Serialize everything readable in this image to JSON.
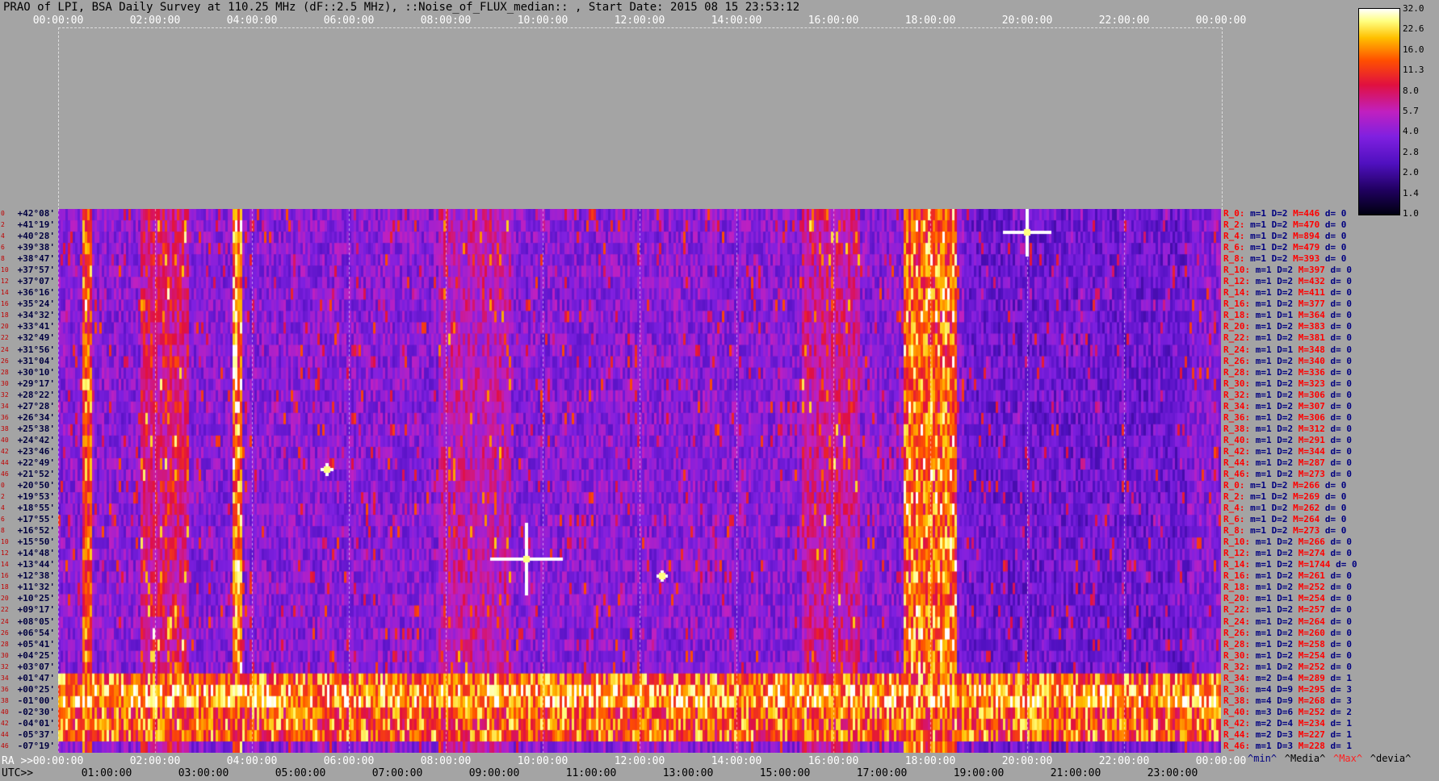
{
  "title": "PRAO of LPI, BSA Daily Survey at 110.25 MHz (dF::2.5 MHz), ::Noise_of_FLUX_median:: , Start Date: 2015 08 15 23:53:12",
  "top_ticks": [
    "00:00:00",
    "02:00:00",
    "04:00:00",
    "06:00:00",
    "08:00:00",
    "10:00:00",
    "12:00:00",
    "14:00:00",
    "16:00:00",
    "18:00:00",
    "20:00:00",
    "22:00:00",
    "00:00:00"
  ],
  "ra_label": "RA >>",
  "utc_label": "UTC>>",
  "ra_ticks": [
    "00:00:00",
    "02:00:00",
    "04:00:00",
    "06:00:00",
    "08:00:00",
    "10:00:00",
    "12:00:00",
    "14:00:00",
    "16:00:00",
    "18:00:00",
    "20:00:00",
    "22:00:00",
    "00:00:00"
  ],
  "utc_ticks": [
    "01:00:00",
    "03:00:00",
    "05:00:00",
    "07:00:00",
    "09:00:00",
    "11:00:00",
    "13:00:00",
    "15:00:00",
    "17:00:00",
    "19:00:00",
    "21:00:00",
    "23:00:00"
  ],
  "colorbar_labels": [
    "32.0",
    "22.6",
    "16.0",
    "11.3",
    "8.0",
    "5.7",
    "4.0",
    "2.8",
    "2.0",
    "1.4",
    "1.0"
  ],
  "legend_keys": {
    "min": "^min^",
    "median": "^Media^",
    "max": "^Max^",
    "devia": "^devia^"
  },
  "colors": {
    "background": "#a4a4a4",
    "stat_label": "#ff0000",
    "stat_value": "#000080",
    "max_key": "#ff2020"
  },
  "chart_data": {
    "type": "heatmap",
    "x_axis": "Right Ascension / UTC",
    "x_range": [
      "00:00:00",
      "24:00:00"
    ],
    "color_scale": [
      1.0,
      32.0
    ],
    "rows": [
      {
        "idx": "0",
        "dec": "+42°08'",
        "stat": {
          "r": "R_0:",
          "m": "m=1",
          "D": "D=2",
          "M": "M=446",
          "d": "d= 0"
        }
      },
      {
        "idx": "2",
        "dec": "+41°19'",
        "stat": {
          "r": "R_2:",
          "m": "m=1",
          "D": "D=2",
          "M": "M=470",
          "d": "d= 0"
        }
      },
      {
        "idx": "4",
        "dec": "+40°28'",
        "stat": {
          "r": "R_4:",
          "m": "m=1",
          "D": "D=2",
          "M": "M=894",
          "d": "d= 0"
        }
      },
      {
        "idx": "6",
        "dec": "+39°38'",
        "stat": {
          "r": "R_6:",
          "m": "m=1",
          "D": "D=2",
          "M": "M=479",
          "d": "d= 0"
        }
      },
      {
        "idx": "8",
        "dec": "+38°47'",
        "stat": {
          "r": "R_8:",
          "m": "m=1",
          "D": "D=2",
          "M": "M=393",
          "d": "d= 0"
        }
      },
      {
        "idx": "10",
        "dec": "+37°57'",
        "stat": {
          "r": "R_10:",
          "m": "m=1",
          "D": "D=2",
          "M": "M=397",
          "d": "d= 0"
        }
      },
      {
        "idx": "12",
        "dec": "+37°07'",
        "stat": {
          "r": "R_12:",
          "m": "m=1",
          "D": "D=2",
          "M": "M=432",
          "d": "d= 0"
        }
      },
      {
        "idx": "14",
        "dec": "+36°16'",
        "stat": {
          "r": "R_14:",
          "m": "m=1",
          "D": "D=2",
          "M": "M=411",
          "d": "d= 0"
        }
      },
      {
        "idx": "16",
        "dec": "+35°24'",
        "stat": {
          "r": "R_16:",
          "m": "m=1",
          "D": "D=2",
          "M": "M=377",
          "d": "d= 0"
        }
      },
      {
        "idx": "18",
        "dec": "+34°32'",
        "stat": {
          "r": "R_18:",
          "m": "m=1",
          "D": "D=1",
          "M": "M=364",
          "d": "d= 0"
        }
      },
      {
        "idx": "20",
        "dec": "+33°41'",
        "stat": {
          "r": "R_20:",
          "m": "m=1",
          "D": "D=2",
          "M": "M=383",
          "d": "d= 0"
        }
      },
      {
        "idx": "22",
        "dec": "+32°49'",
        "stat": {
          "r": "R_22:",
          "m": "m=1",
          "D": "D=2",
          "M": "M=381",
          "d": "d= 0"
        }
      },
      {
        "idx": "24",
        "dec": "+31°56'",
        "stat": {
          "r": "R_24:",
          "m": "m=1",
          "D": "D=1",
          "M": "M=348",
          "d": "d= 0"
        }
      },
      {
        "idx": "26",
        "dec": "+31°04'",
        "stat": {
          "r": "R_26:",
          "m": "m=1",
          "D": "D=2",
          "M": "M=340",
          "d": "d= 0"
        }
      },
      {
        "idx": "28",
        "dec": "+30°10'",
        "stat": {
          "r": "R_28:",
          "m": "m=1",
          "D": "D=2",
          "M": "M=336",
          "d": "d= 0"
        }
      },
      {
        "idx": "30",
        "dec": "+29°17'",
        "stat": {
          "r": "R_30:",
          "m": "m=1",
          "D": "D=2",
          "M": "M=323",
          "d": "d= 0"
        }
      },
      {
        "idx": "32",
        "dec": "+28°22'",
        "stat": {
          "r": "R_32:",
          "m": "m=1",
          "D": "D=2",
          "M": "M=306",
          "d": "d= 0"
        }
      },
      {
        "idx": "34",
        "dec": "+27°28'",
        "stat": {
          "r": "R_34:",
          "m": "m=1",
          "D": "D=2",
          "M": "M=307",
          "d": "d= 0"
        }
      },
      {
        "idx": "36",
        "dec": "+26°34'",
        "stat": {
          "r": "R_36:",
          "m": "m=1",
          "D": "D=2",
          "M": "M=306",
          "d": "d= 0"
        }
      },
      {
        "idx": "38",
        "dec": "+25°38'",
        "stat": {
          "r": "R_38:",
          "m": "m=1",
          "D": "D=2",
          "M": "M=312",
          "d": "d= 0"
        }
      },
      {
        "idx": "40",
        "dec": "+24°42'",
        "stat": {
          "r": "R_40:",
          "m": "m=1",
          "D": "D=2",
          "M": "M=291",
          "d": "d= 0"
        }
      },
      {
        "idx": "42",
        "dec": "+23°46'",
        "stat": {
          "r": "R_42:",
          "m": "m=1",
          "D": "D=2",
          "M": "M=344",
          "d": "d= 0"
        }
      },
      {
        "idx": "44",
        "dec": "+22°49'",
        "stat": {
          "r": "R_44:",
          "m": "m=1",
          "D": "D=2",
          "M": "M=287",
          "d": "d= 0"
        }
      },
      {
        "idx": "46",
        "dec": "+21°52'",
        "stat": {
          "r": "R_46:",
          "m": "m=1",
          "D": "D=2",
          "M": "M=273",
          "d": "d= 0"
        }
      },
      {
        "idx": "0",
        "dec": "+20°50'",
        "stat": {
          "r": "R_0:",
          "m": "m=1",
          "D": "D=2",
          "M": "M=266",
          "d": "d= 0"
        }
      },
      {
        "idx": "2",
        "dec": "+19°53'",
        "stat": {
          "r": "R_2:",
          "m": "m=1",
          "D": "D=2",
          "M": "M=269",
          "d": "d= 0"
        }
      },
      {
        "idx": "4",
        "dec": "+18°55'",
        "stat": {
          "r": "R_4:",
          "m": "m=1",
          "D": "D=2",
          "M": "M=262",
          "d": "d= 0"
        }
      },
      {
        "idx": "6",
        "dec": "+17°55'",
        "stat": {
          "r": "R_6:",
          "m": "m=1",
          "D": "D=2",
          "M": "M=264",
          "d": "d= 0"
        }
      },
      {
        "idx": "8",
        "dec": "+16°52'",
        "stat": {
          "r": "R_8:",
          "m": "m=1",
          "D": "D=2",
          "M": "M=273",
          "d": "d= 0"
        }
      },
      {
        "idx": "10",
        "dec": "+15°50'",
        "stat": {
          "r": "R_10:",
          "m": "m=1",
          "D": "D=2",
          "M": "M=266",
          "d": "d= 0"
        }
      },
      {
        "idx": "12",
        "dec": "+14°48'",
        "stat": {
          "r": "R_12:",
          "m": "m=1",
          "D": "D=2",
          "M": "M=274",
          "d": "d= 0"
        }
      },
      {
        "idx": "14",
        "dec": "+13°44'",
        "stat": {
          "r": "R_14:",
          "m": "m=1",
          "D": "D=2",
          "M": "M=1744",
          "d": "d= 0"
        }
      },
      {
        "idx": "16",
        "dec": "+12°38'",
        "stat": {
          "r": "R_16:",
          "m": "m=1",
          "D": "D=2",
          "M": "M=261",
          "d": "d= 0"
        }
      },
      {
        "idx": "18",
        "dec": "+11°32'",
        "stat": {
          "r": "R_18:",
          "m": "m=1",
          "D": "D=2",
          "M": "M=252",
          "d": "d= 0"
        }
      },
      {
        "idx": "20",
        "dec": "+10°25'",
        "stat": {
          "r": "R_20:",
          "m": "m=1",
          "D": "D=1",
          "M": "M=254",
          "d": "d= 0"
        }
      },
      {
        "idx": "22",
        "dec": "+09°17'",
        "stat": {
          "r": "R_22:",
          "m": "m=1",
          "D": "D=2",
          "M": "M=257",
          "d": "d= 0"
        }
      },
      {
        "idx": "24",
        "dec": "+08°05'",
        "stat": {
          "r": "R_24:",
          "m": "m=1",
          "D": "D=2",
          "M": "M=264",
          "d": "d= 0"
        }
      },
      {
        "idx": "26",
        "dec": "+06°54'",
        "stat": {
          "r": "R_26:",
          "m": "m=1",
          "D": "D=2",
          "M": "M=260",
          "d": "d= 0"
        }
      },
      {
        "idx": "28",
        "dec": "+05°41'",
        "stat": {
          "r": "R_28:",
          "m": "m=1",
          "D": "D=2",
          "M": "M=258",
          "d": "d= 0"
        }
      },
      {
        "idx": "30",
        "dec": "+04°25'",
        "stat": {
          "r": "R_30:",
          "m": "m=1",
          "D": "D=2",
          "M": "M=254",
          "d": "d= 0"
        }
      },
      {
        "idx": "32",
        "dec": "+03°07'",
        "stat": {
          "r": "R_32:",
          "m": "m=1",
          "D": "D=2",
          "M": "M=252",
          "d": "d= 0"
        }
      },
      {
        "idx": "34",
        "dec": "+01°47'",
        "stat": {
          "r": "R_34:",
          "m": "m=2",
          "D": "D=4",
          "M": "M=289",
          "d": "d= 1"
        }
      },
      {
        "idx": "36",
        "dec": "+00°25'",
        "stat": {
          "r": "R_36:",
          "m": "m=4",
          "D": "D=9",
          "M": "M=295",
          "d": "d= 3"
        }
      },
      {
        "idx": "38",
        "dec": "-01°00'",
        "stat": {
          "r": "R_38:",
          "m": "m=4",
          "D": "D=9",
          "M": "M=268",
          "d": "d= 3"
        }
      },
      {
        "idx": "40",
        "dec": "-02°30'",
        "stat": {
          "r": "R_40:",
          "m": "m=3",
          "D": "D=6",
          "M": "M=252",
          "d": "d= 2"
        }
      },
      {
        "idx": "42",
        "dec": "-04°01'",
        "stat": {
          "r": "R_42:",
          "m": "m=2",
          "D": "D=4",
          "M": "M=234",
          "d": "d= 1"
        }
      },
      {
        "idx": "44",
        "dec": "-05°37'",
        "stat": {
          "r": "R_44:",
          "m": "m=2",
          "D": "D=3",
          "M": "M=227",
          "d": "d= 1"
        }
      },
      {
        "idx": "46",
        "dec": "-07°19'",
        "stat": {
          "r": "R_46:",
          "m": "m=1",
          "D": "D=3",
          "M": "M=228",
          "d": "d= 1"
        }
      }
    ]
  }
}
